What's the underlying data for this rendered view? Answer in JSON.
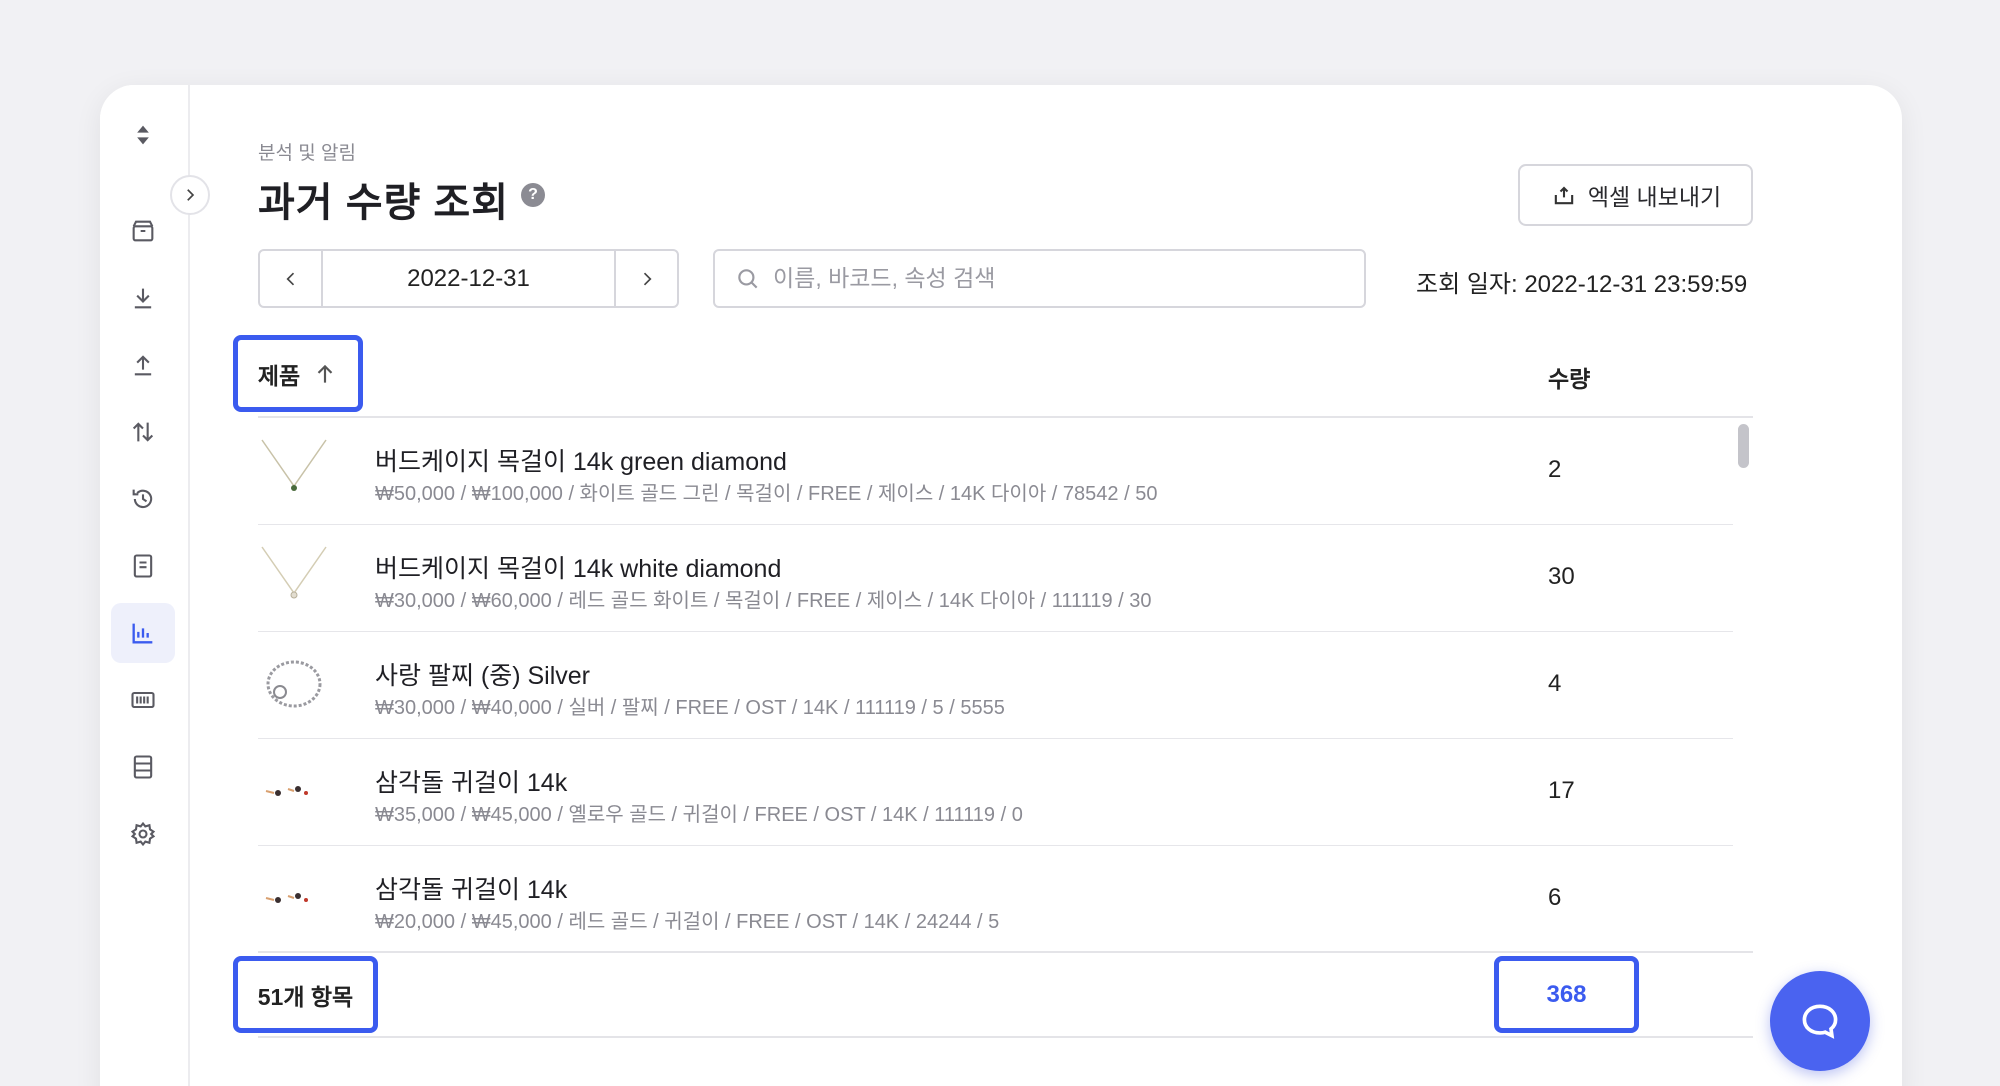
{
  "breadcrumb": "분석 및 알림",
  "page_title": "과거 수량 조회",
  "export_label": "엑셀 내보내기",
  "date_selector": {
    "value": "2022-12-31"
  },
  "search": {
    "placeholder": "이름, 바코드, 속성 검색"
  },
  "query_date": "조회 일자: 2022-12-31 23:59:59",
  "table": {
    "col_product": "제품",
    "col_quantity": "수량",
    "rows": [
      {
        "name": "버드케이지 목걸이 14k green diamond",
        "meta": "₩50,000 / ₩100,000 / 화이트 골드 그린 / 목걸이 / FREE / 제이스 / 14K 다이아 / 78542 / 50",
        "qty": "2",
        "thumb": "necklace-green"
      },
      {
        "name": "버드케이지 목걸이 14k white diamond",
        "meta": "₩30,000 / ₩60,000 / 레드 골드 화이트 / 목걸이 / FREE / 제이스 / 14K 다이아 / 111119 / 30",
        "qty": "30",
        "thumb": "necklace-white"
      },
      {
        "name": "사랑 팔찌 (중) Silver",
        "meta": "₩30,000 / ₩40,000 / 실버 / 팔찌 / FREE / OST / 14K / 111119 / 5 / 5555",
        "qty": "4",
        "thumb": "bracelet"
      },
      {
        "name": "삼각돌 귀걸이 14k",
        "meta": "₩35,000 / ₩45,000 / 옐로우 골드 / 귀걸이 / FREE / OST / 14K / 111119 / 0",
        "qty": "17",
        "thumb": "earrings"
      },
      {
        "name": "삼각돌 귀걸이 14k",
        "meta": "₩20,000 / ₩45,000 / 레드 골드 / 귀걸이 / FREE / OST / 14K / 24244 / 5",
        "qty": "6",
        "thumb": "earrings"
      }
    ]
  },
  "footer": {
    "item_count": "51개 항목",
    "total_quantity": "368"
  },
  "sidebar_icons": [
    "sort-updown-icon",
    "box-icon",
    "download-icon",
    "upload-icon",
    "transfer-icon",
    "history-icon",
    "document-icon",
    "chart-icon",
    "barcode-icon",
    "database-icon",
    "settings-icon"
  ],
  "colors": {
    "accent": "#3b5bef",
    "chat": "#4a63f0"
  }
}
